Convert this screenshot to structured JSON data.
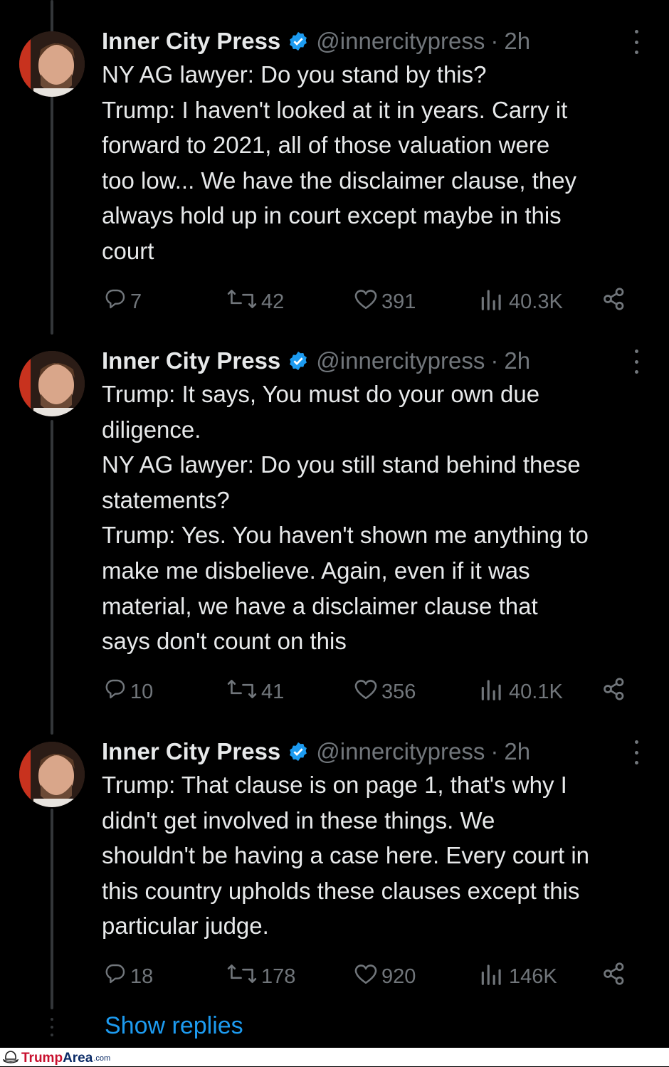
{
  "tweets": [
    {
      "name": "Inner City Press",
      "handle": "@innercitypress",
      "sep": "·",
      "time": "2h",
      "lines": [
        "NY AG lawyer: Do you stand by this?",
        "Trump: I haven't looked at it in years. Carry it",
        "forward to 2021, all of those valuation were",
        "too low... We have the disclaimer clause, they",
        "always hold up in court except maybe in this",
        "court"
      ],
      "replies": "7",
      "retweets": "42",
      "likes": "391",
      "views": "40.3K"
    },
    {
      "name": "Inner City Press",
      "handle": "@innercitypress",
      "sep": "·",
      "time": "2h",
      "lines": [
        "Trump: It says, You must do your own due",
        "diligence.",
        "NY AG lawyer: Do you still stand behind these",
        "statements?",
        "Trump: Yes. You haven't shown me anything to",
        "make me disbelieve. Again, even if it was",
        "material, we have a disclaimer clause that",
        "says don't count on this"
      ],
      "replies": "10",
      "retweets": "41",
      "likes": "356",
      "views": "40.1K"
    },
    {
      "name": "Inner City Press",
      "handle": "@innercitypress",
      "sep": "·",
      "time": "2h",
      "lines": [
        "Trump: That clause is on page 1, that's why I",
        "didn't get involved in these things. We",
        "shouldn't be having a case here. Every court in",
        "this country upholds these clauses except this",
        "particular judge."
      ],
      "replies": "18",
      "retweets": "178",
      "likes": "920",
      "views": "146K"
    }
  ],
  "show_replies": "Show replies",
  "watermark": {
    "main": "Trump",
    "sub": "Area",
    "tld": ".com"
  },
  "colors": {
    "background": "#000000",
    "text": "#e7e9ea",
    "muted": "#71767b",
    "link": "#1d9bf0",
    "verified": "#1d9bf0"
  },
  "icons": [
    "reply-icon",
    "retweet-icon",
    "like-icon",
    "views-icon",
    "share-icon",
    "verified-badge-icon",
    "more-options-icon"
  ]
}
